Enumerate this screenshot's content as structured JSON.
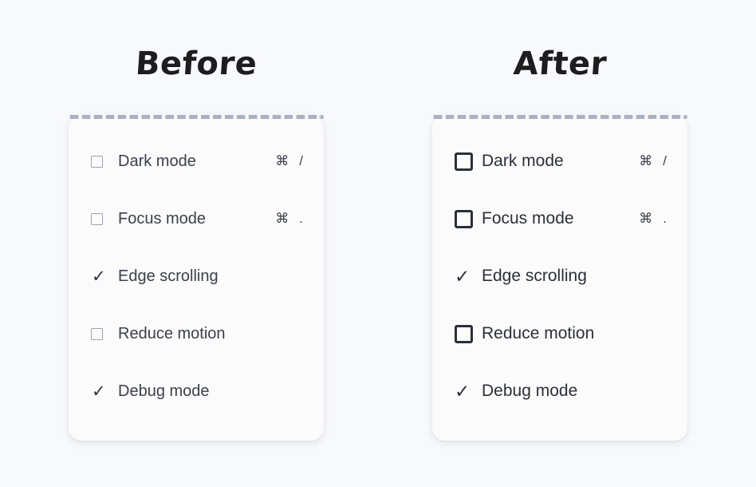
{
  "background_color": "#f7f9fc",
  "panels": [
    {
      "id": "before",
      "title": "Before",
      "card": {
        "background_color": "#fbfbfc",
        "dashed_border_color": "#a9b2c0",
        "checkbox_border_color": "#9ca3af",
        "label_color": "#3b4049"
      },
      "rows": [
        {
          "label": "Dark mode",
          "state": "unchecked",
          "mark": "□",
          "shortcut_modifier": "⌘",
          "shortcut_key": "/"
        },
        {
          "label": "Focus mode",
          "state": "unchecked",
          "mark": "□",
          "shortcut_modifier": "⌘",
          "shortcut_key": "."
        },
        {
          "label": "Edge scrolling",
          "state": "checked",
          "mark": "✓",
          "shortcut_modifier": "",
          "shortcut_key": ""
        },
        {
          "label": "Reduce motion",
          "state": "unchecked",
          "mark": "□",
          "shortcut_modifier": "",
          "shortcut_key": ""
        },
        {
          "label": "Debug mode",
          "state": "checked",
          "mark": "✓",
          "shortcut_modifier": "",
          "shortcut_key": ""
        }
      ]
    },
    {
      "id": "after",
      "title": "After",
      "card": {
        "background_color": "#fbfbfc",
        "dashed_border_color": "#a9b2c0",
        "checkbox_border_color": "#2b3038",
        "label_color": "#2b3038"
      },
      "rows": [
        {
          "label": "Dark mode",
          "state": "unchecked",
          "mark": "□",
          "shortcut_modifier": "⌘",
          "shortcut_key": "/"
        },
        {
          "label": "Focus mode",
          "state": "unchecked",
          "mark": "□",
          "shortcut_modifier": "⌘",
          "shortcut_key": "."
        },
        {
          "label": "Edge scrolling",
          "state": "checked",
          "mark": "✓",
          "shortcut_modifier": "",
          "shortcut_key": ""
        },
        {
          "label": "Reduce motion",
          "state": "unchecked",
          "mark": "□",
          "shortcut_modifier": "",
          "shortcut_key": ""
        },
        {
          "label": "Debug mode",
          "state": "checked",
          "mark": "✓",
          "shortcut_modifier": "",
          "shortcut_key": ""
        }
      ]
    }
  ]
}
